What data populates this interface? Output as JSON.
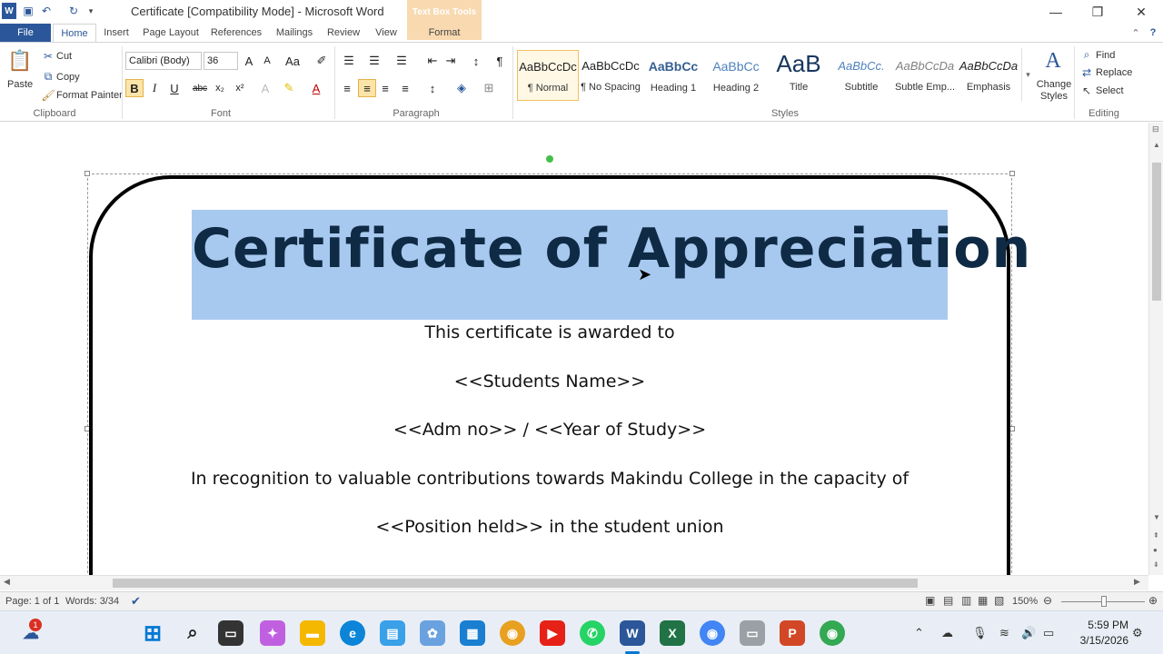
{
  "window": {
    "title": "Certificate [Compatibility Mode]  -  Microsoft Word",
    "context_group": "Text Box Tools"
  },
  "tabs": {
    "file": "File",
    "items": [
      "Home",
      "Insert",
      "Page Layout",
      "References",
      "Mailings",
      "Review",
      "View"
    ],
    "format": "Format"
  },
  "ribbon": {
    "clipboard": {
      "paste": "Paste",
      "cut": "Cut",
      "copy": "Copy",
      "format_painter": "Format Painter",
      "label": "Clipboard"
    },
    "font": {
      "name": "Calibri (Body)",
      "size": "36",
      "label": "Font"
    },
    "paragraph": {
      "label": "Paragraph"
    },
    "styles": {
      "label": "Styles",
      "items": [
        {
          "sample": "AaBbCcDc",
          "name": "¶ Normal"
        },
        {
          "sample": "AaBbCcDc",
          "name": "¶ No Spacing"
        },
        {
          "sample": "AaBbCc",
          "name": "Heading 1"
        },
        {
          "sample": "AaBbCc",
          "name": "Heading 2"
        },
        {
          "sample": "AaB",
          "name": "Title"
        },
        {
          "sample": "AaBbCc.",
          "name": "Subtitle"
        },
        {
          "sample": "AaBbCcDa",
          "name": "Subtle Emp..."
        },
        {
          "sample": "AaBbCcDa",
          "name": "Emphasis"
        }
      ],
      "change_styles": "Change Styles"
    },
    "editing": {
      "find": "Find",
      "replace": "Replace",
      "select": "Select",
      "label": "Editing"
    }
  },
  "document": {
    "title": "Certificate of Appreciation",
    "line1": "This certificate is awarded to",
    "line2": "<<Students Name>>",
    "line3": "<<Adm no>> / <<Year of Study>>",
    "line4": "In recognition to valuable contributions towards Makindu College in the capacity of",
    "line5": "<<Position held>> in the student union"
  },
  "status": {
    "page": "Page: 1 of 1",
    "words": "Words: 3/34",
    "zoom": "150%"
  },
  "taskbar": {
    "badge": "1",
    "time": "5:59 PM",
    "date": "3/15/2026"
  },
  "colors": {
    "word_blue": "#2b579a",
    "selection": "#a8c9ef",
    "title_text": "#0f2a44",
    "context_tab": "#f8d9b0"
  }
}
